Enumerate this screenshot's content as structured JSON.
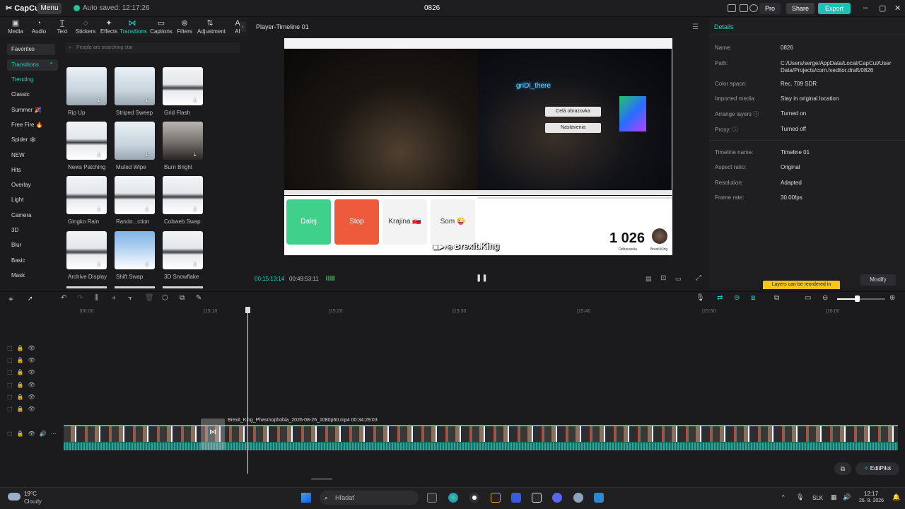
{
  "titlebar": {
    "logo": "CapCut",
    "menu": "Menu",
    "autosave": "Auto saved: 12:17:26",
    "title": "0826",
    "pro": "Pro",
    "share": "Share",
    "export": "Export"
  },
  "toolbar": [
    {
      "label": "Media",
      "icon": "media-icon"
    },
    {
      "label": "Audio",
      "icon": "audio-icon"
    },
    {
      "label": "Text",
      "icon": "text-icon"
    },
    {
      "label": "Stickers",
      "icon": "stickers-icon"
    },
    {
      "label": "Effects",
      "icon": "effects-icon"
    },
    {
      "label": "Transitions",
      "icon": "transitions-icon"
    },
    {
      "label": "Captions",
      "icon": "captions-icon"
    },
    {
      "label": "Filters",
      "icon": "filters-icon"
    },
    {
      "label": "Adjustment",
      "icon": "adjustment-icon"
    },
    {
      "label": "AI",
      "icon": "ai-icon"
    }
  ],
  "categories": {
    "favorites": "Favorites",
    "transitions": "Transitions",
    "items": [
      "Trending",
      "Classic",
      "Summer 🎉",
      "Free Fire 🔥",
      "Spider 🕸",
      "NEW",
      "Hits",
      "Overlay",
      "Light",
      "Camera",
      "3D",
      "Blur",
      "Basic",
      "Mask"
    ]
  },
  "search": {
    "placeholder": "People are searching star"
  },
  "effects": [
    {
      "label": "Rip Up",
      "style": "tower"
    },
    {
      "label": "Striped Sweep",
      "style": "tower"
    },
    {
      "label": "Grid Flash",
      "style": "mtn"
    },
    {
      "label": "News Patching",
      "style": "mtn"
    },
    {
      "label": "Muted Wipe",
      "style": "tower"
    },
    {
      "label": "Burn Bright",
      "style": "person"
    },
    {
      "label": "Gingko Rain",
      "style": "mtn"
    },
    {
      "label": "Rando...ction",
      "style": "mtn"
    },
    {
      "label": "Cobweb Swap",
      "style": "mtn"
    },
    {
      "label": "Archive Display",
      "style": "mtn"
    },
    {
      "label": "Shift Swap",
      "style": "house"
    },
    {
      "label": "3D Snowflake",
      "style": "mtn"
    }
  ],
  "player": {
    "title": "Player-Timeline 01",
    "timecode": "00:15:13:14",
    "duration": "00:49:53:11",
    "video": {
      "buttons": [
        {
          "label": "Dalej",
          "color": "#3fd08c"
        },
        {
          "label": "Stop",
          "color": "#ee5a3c"
        },
        {
          "label": "Krajina 🇸🇰",
          "color": "#f3f3f3"
        },
        {
          "label": "Som 😜",
          "color": "#f3f3f3"
        }
      ],
      "count": "1 026",
      "count_label": "Odberatelia",
      "channel": "Brexit.King",
      "neon": "griDl_there",
      "overlay_btn1": "Celá obrazovka",
      "overlay_btn2": "Nastavenia"
    }
  },
  "details": {
    "title": "Details",
    "fields": [
      {
        "key": "Name:",
        "value": "0826"
      },
      {
        "key": "Path:",
        "value": "C:/Users/serge/AppData/Local/CapCut/User Data/Projects/com.lveditor.draft/0826"
      },
      {
        "key": "Color space:",
        "value": "Rec. 709 SDR"
      },
      {
        "key": "Imported media:",
        "value": "Stay in original location"
      },
      {
        "key": "Arrange layers ⓘ",
        "value": "Turned on"
      },
      {
        "key": "Proxy: ⓘ",
        "value": "Turned off"
      },
      {
        "key": "Timeline name:",
        "value": "Timeline 01"
      },
      {
        "key": "Aspect ratio:",
        "value": "Original"
      },
      {
        "key": "Resolution:",
        "value": "Adapted"
      },
      {
        "key": "Frame rate:",
        "value": "30.00fps"
      }
    ],
    "tooltip": "Layers can be reordered in",
    "modify": "Modify"
  },
  "timeline": {
    "ticks": [
      "|00:00",
      "|15:10",
      "|15:20",
      "|15:30",
      "|15:40",
      "|15:50",
      "|16:00"
    ],
    "clip_label": "Brexit_King_Phasmophobia_2026-08-26_1080p60.mp4   00:34:29:03",
    "editpilot": "EditPilot"
  },
  "taskbar": {
    "temp": "19°C",
    "weather": "Cloudy",
    "search": "Hľadať",
    "lang": "SLK",
    "time": "12:17",
    "date": "26. 8. 2026"
  }
}
